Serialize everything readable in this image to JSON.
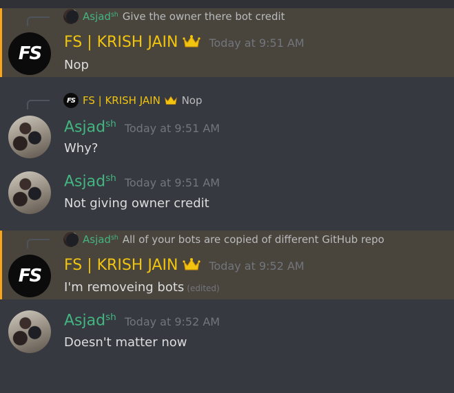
{
  "messages": [
    {
      "highlight": true,
      "reply": {
        "author": "Asjad",
        "author_sup": "sh",
        "text": "Give the owner there bot credit"
      },
      "author": "FS | KRISH JAIN",
      "time": "Today at 9:51 AM",
      "text": "Nop"
    },
    {
      "reply": {
        "author": "FS | KRISH JAIN",
        "text": "Nop"
      },
      "author": "Asjad",
      "author_sup": "sh",
      "time": "Today at 9:51 AM",
      "text": "Why?"
    },
    {
      "author": "Asjad",
      "author_sup": "sh",
      "time": "Today at 9:51 AM",
      "text": "Not giving owner credit"
    },
    {
      "highlight": true,
      "reply": {
        "author": "Asjad",
        "author_sup": "sh",
        "text": "All of your bots are copied of different GitHub repo"
      },
      "author": "FS | KRISH JAIN",
      "time": "Today at 9:52 AM",
      "text": "I'm removeing bots",
      "edited": "(edited)"
    },
    {
      "author": "Asjad",
      "author_sup": "sh",
      "time": "Today at 9:52 AM",
      "text": "Doesn't matter now"
    }
  ],
  "avatars": {
    "fs_label": "FS"
  },
  "colors": {
    "highlight_bg": "#49443c",
    "highlight_bar": "#faa61a",
    "green": "#43b581",
    "gold": "#f1c40f"
  },
  "icons": {
    "crown": "crown-icon"
  }
}
